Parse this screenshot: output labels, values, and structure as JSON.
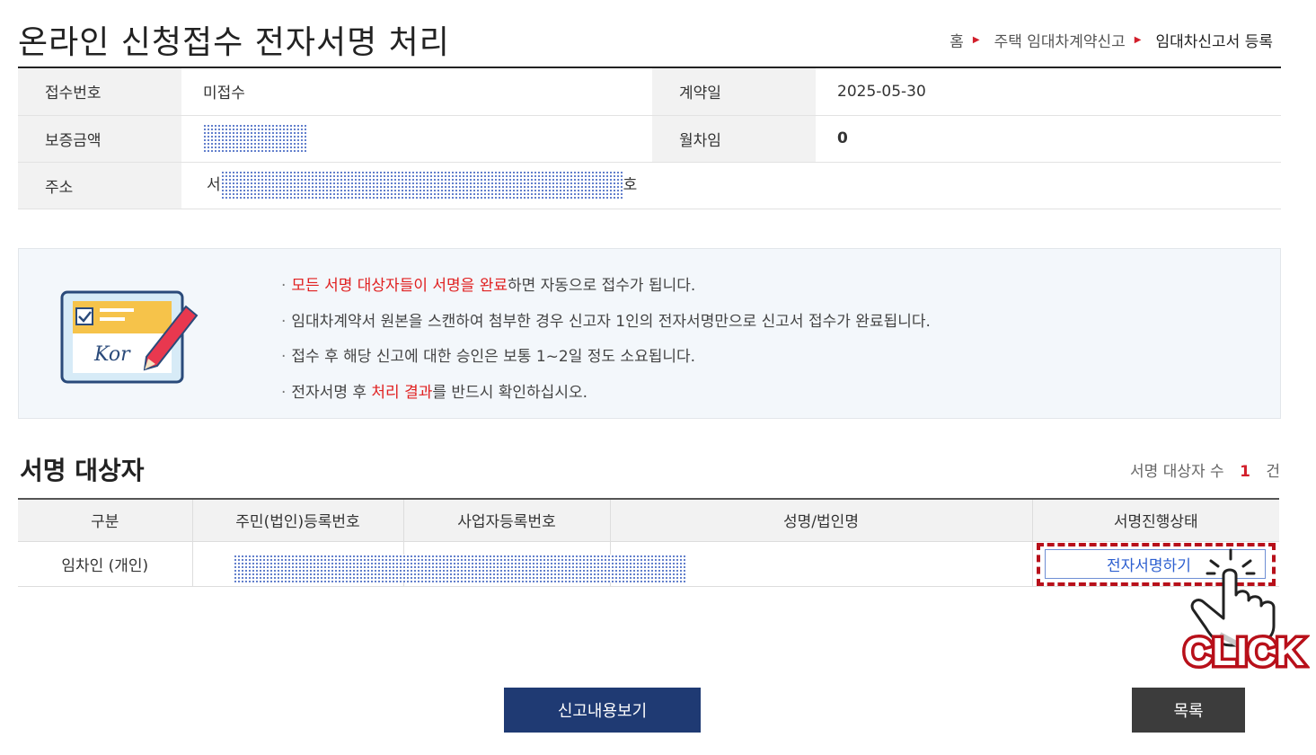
{
  "page": {
    "title": "온라인 신청접수 전자서명 처리"
  },
  "breadcrumb": [
    "홈",
    "주택 임대차계약신고",
    "임대차신고서 등록"
  ],
  "info": {
    "receipt_no_label": "접수번호",
    "receipt_no_value": "미접수",
    "contract_date_label": "계약일",
    "contract_date_value": "2025-05-30",
    "deposit_label": "보증금액",
    "monthly_rent_label": "월차임",
    "monthly_rent_value": "0",
    "address_label": "주소",
    "address_prefix": "서",
    "address_suffix": "호"
  },
  "notice": {
    "icon_text": "Kor",
    "items": [
      {
        "highlight": "모든 서명 대상자들이 서명을 완료",
        "rest": "하면 자동으로 접수가 됩니다."
      },
      {
        "text": "임대차계약서 원본을 스캔하여 첨부한 경우 신고자 1인의 전자서명만으로 신고서 접수가 완료됩니다."
      },
      {
        "text": "접수 후 해당 신고에 대한 승인은 보통 1~2일 정도 소요됩니다."
      },
      {
        "before": "전자서명 후 ",
        "highlight": "처리 결과",
        "after": "를 반드시 확인하십시오."
      }
    ]
  },
  "signers": {
    "title": "서명 대상자",
    "count_label": "서명 대상자 수",
    "count": "1",
    "count_unit": "건",
    "columns": [
      "구분",
      "주민(법인)등록번호",
      "사업자등록번호",
      "성명/법인명",
      "서명진행상태"
    ],
    "rows": [
      {
        "type": "임차인 (개인)",
        "sign_button": "전자서명하기"
      }
    ]
  },
  "overlay": {
    "click_text": "CLICK"
  },
  "buttons": {
    "view": "신고내용보기",
    "list": "목록"
  },
  "colors": {
    "navy": "#1f3a73",
    "dark": "#3c3c3c",
    "accent_red": "#e02020",
    "highlight_border": "#b8101a",
    "link_blue": "#2d5fd0"
  }
}
